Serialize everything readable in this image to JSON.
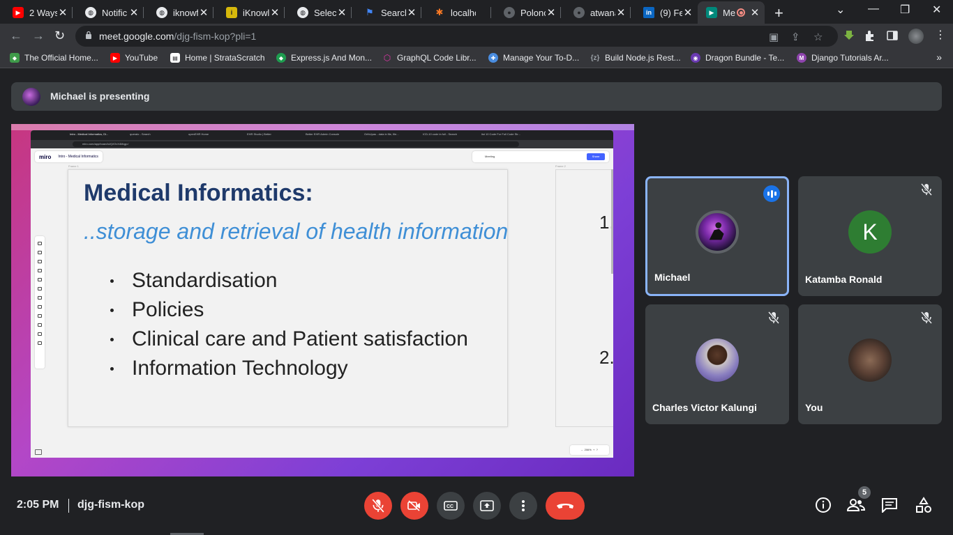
{
  "browser": {
    "tabs": [
      {
        "title": "2 Ways",
        "icon": "youtube-icon",
        "color": "#ff0000"
      },
      {
        "title": "Notific",
        "icon": "globe-icon",
        "color": "#e8eaed"
      },
      {
        "title": "iknowf",
        "icon": "globe-icon",
        "color": "#e8eaed"
      },
      {
        "title": "iKnowl",
        "icon": "iknow-icon",
        "color": "#d6b80b"
      },
      {
        "title": "Select",
        "icon": "globe-icon",
        "color": "#e8eaed"
      },
      {
        "title": "Search",
        "icon": "flag-icon",
        "color": "#4285f4"
      },
      {
        "title": "localhc",
        "icon": "xampp-icon",
        "color": "#fb7a24"
      },
      {
        "title": "Polonc",
        "icon": "github-icon",
        "color": "#5f6368"
      },
      {
        "title": "atwana",
        "icon": "github-icon",
        "color": "#5f6368"
      },
      {
        "title": "(9) Fee",
        "icon": "linkedin-icon",
        "color": "#0a66c2"
      },
      {
        "title": "Me",
        "icon": "meet-icon",
        "color": "#00897b",
        "active": true
      }
    ],
    "url_domain": "meet.google.com",
    "url_path": "/djg-fism-kop?pli=1",
    "bookmarks": [
      {
        "label": "The Official Home...",
        "icon": "mongodb-icon",
        "color": "#3f9b4a"
      },
      {
        "label": "YouTube",
        "icon": "youtube-icon",
        "color": "#ff0000"
      },
      {
        "label": "Home | StrataScratch",
        "icon": "stratascratch-icon",
        "color": "#ffffff"
      },
      {
        "label": "Express.js And Mon...",
        "icon": "express-icon",
        "color": "#1e9c4f"
      },
      {
        "label": "GraphQL Code Libr...",
        "icon": "graphql-icon",
        "color": "#e535ab"
      },
      {
        "label": "Manage Your To-D...",
        "icon": "todo-icon",
        "color": "#4a8de0"
      },
      {
        "label": "Build Node.js Rest...",
        "icon": "code-icon",
        "color": "#9aa0a6"
      },
      {
        "label": "Dragon Bundle - Te...",
        "icon": "dragon-icon",
        "color": "#6a3ab2"
      },
      {
        "label": "Django Tutorials Ar...",
        "icon": "django-icon",
        "color": "#8e44ad"
      }
    ],
    "bookmarks_more": "»"
  },
  "meet": {
    "presenting_text": "Michael is presenting",
    "participants": [
      {
        "name": "Michael",
        "speaking": true,
        "muted": false
      },
      {
        "name": "Katamba Ronald",
        "initial": "K",
        "muted": true,
        "avatar_color": "#2e7d32"
      },
      {
        "name": "Charles Victor Kalungi",
        "muted": true
      },
      {
        "name": "You",
        "muted": true
      }
    ],
    "time": "2:05 PM",
    "meeting_code": "djg-fism-kop",
    "people_count": "5",
    "colors": {
      "end_call": "#ea4335",
      "muted": "#ea4335",
      "speaking_border": "#8ab4f8"
    }
  },
  "shared_screen": {
    "inner_tabs": [
      "Intro - Medical Informatics, Di...",
      "queralo - Search",
      "openEHR Home",
      "EHR Studio | Better",
      "Better EHR Admin Console",
      "OrthUpas - data in file, file...",
      "ICD-10 code in full - Search",
      "list 10 Code For Full Code Str..."
    ],
    "inner_url_domain": "miro.com",
    "inner_url_path": "/app/board/uXjVOvX4Mqg=/",
    "miro_logo": "miro",
    "miro_board_name": "Intro - Medical Informatics",
    "miro_meeting": "Meeting",
    "miro_share": "Share",
    "frame1_label": "Frame 1",
    "frame2_label": "Frame 2",
    "slide": {
      "title": "Medical Informatics:",
      "subtitle": "..storage and retrieval of health information",
      "bullets": [
        "Standardisation",
        "Policies",
        "Clinical care and Patient satisfaction",
        "Information Technology"
      ]
    },
    "frame2_items": [
      "1.",
      "2."
    ],
    "zoom": "206%"
  }
}
